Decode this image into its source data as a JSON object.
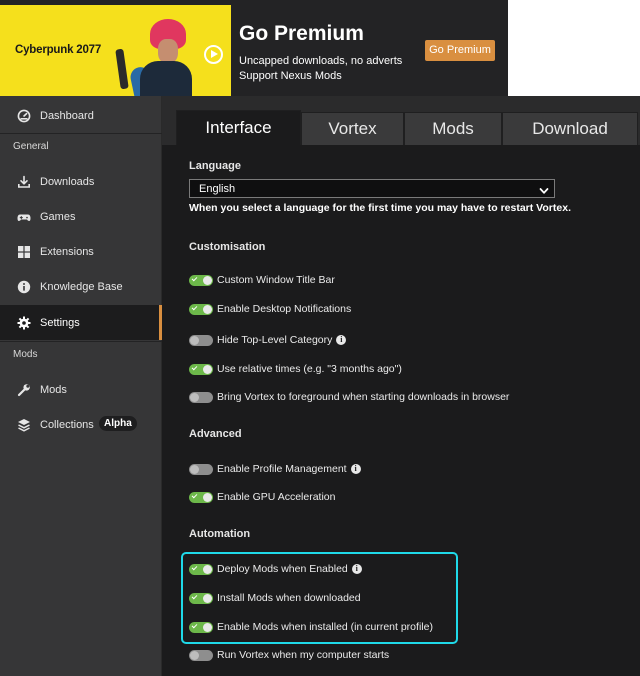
{
  "banner": {
    "game_title": "Cyberpunk 2077",
    "premium_title": "Go Premium",
    "premium_line1": "Uncapped downloads, no adverts",
    "premium_line2": "Support Nexus Mods",
    "premium_button": "Go Premium"
  },
  "sidebar": {
    "dashboard": "Dashboard",
    "section_general": "General",
    "general_items": [
      {
        "label": "Downloads",
        "icon": "download-icon"
      },
      {
        "label": "Games",
        "icon": "gamepad-icon"
      },
      {
        "label": "Extensions",
        "icon": "puzzle-icon"
      },
      {
        "label": "Knowledge Base",
        "icon": "info-circle-icon"
      },
      {
        "label": "Settings",
        "icon": "gear-icon",
        "active": true
      }
    ],
    "section_mods": "Mods",
    "mods_items": [
      {
        "label": "Mods",
        "icon": "wrench-icon"
      },
      {
        "label": "Collections",
        "icon": "layers-icon",
        "badge": "Alpha"
      }
    ]
  },
  "tabs": [
    {
      "label": "Interface",
      "active": true
    },
    {
      "label": "Vortex"
    },
    {
      "label": "Mods"
    },
    {
      "label": "Download"
    }
  ],
  "settings": {
    "language_heading": "Language",
    "language_value": "English",
    "language_note": "When you select a language for the first time you may have to restart Vortex.",
    "customisation_heading": "Customisation",
    "customisation": [
      {
        "label": "Custom Window Title Bar",
        "on": true
      },
      {
        "label": "Enable Desktop Notifications",
        "on": true
      },
      {
        "label": "Hide Top-Level Category",
        "on": false,
        "info": true
      },
      {
        "label": "Use relative times (e.g. \"3 months ago\")",
        "on": true
      },
      {
        "label": "Bring Vortex to foreground when starting downloads in browser",
        "on": false
      }
    ],
    "advanced_heading": "Advanced",
    "advanced": [
      {
        "label": "Enable Profile Management",
        "on": false,
        "info": true
      },
      {
        "label": "Enable GPU Acceleration",
        "on": true
      }
    ],
    "automation_heading": "Automation",
    "automation": [
      {
        "label": "Deploy Mods when Enabled",
        "on": true,
        "info": true
      },
      {
        "label": "Install Mods when downloaded",
        "on": true
      },
      {
        "label": "Enable Mods when installed (in current profile)",
        "on": true
      },
      {
        "label": "Run Vortex when my computer starts",
        "on": false
      }
    ]
  },
  "colors": {
    "accent": "#d98f40",
    "toggle_on": "#6db84a",
    "highlight": "#1fd9e8"
  }
}
